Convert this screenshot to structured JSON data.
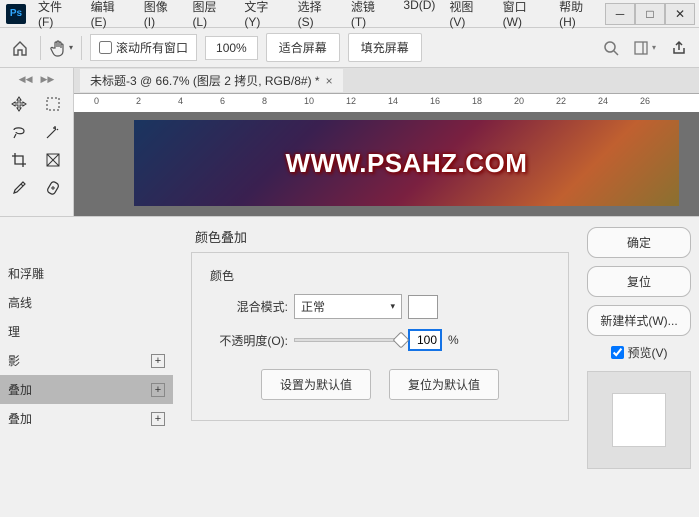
{
  "menu": {
    "file": "文件(F)",
    "edit": "编辑(E)",
    "image": "图像(I)",
    "layer": "图层(L)",
    "type": "文字(Y)",
    "select": "选择(S)",
    "filter": "滤镜(T)",
    "threeD": "3D(D)",
    "view": "视图(V)",
    "window": "窗口(W)",
    "help": "帮助(H)"
  },
  "toolbar": {
    "scroll_all": "滚动所有窗口",
    "zoom": "100%",
    "fit_screen": "适合屏幕",
    "fill_screen": "填充屏幕"
  },
  "doc": {
    "tab": "未标题-3 @ 66.7% (图层 2 拷贝, RGB/8#) *",
    "watermark": "WWW.PSAHZ.COM",
    "ruler": [
      "0",
      "2",
      "4",
      "6",
      "8",
      "10",
      "12",
      "14",
      "16",
      "18",
      "20",
      "22",
      "24",
      "26"
    ]
  },
  "dialog": {
    "styles": {
      "a": "",
      "b": "和浮雕",
      "c": "高线",
      "d": "理",
      "e": "影",
      "f": "叠加",
      "g": "叠加"
    },
    "title": "颜色叠加",
    "section": "颜色",
    "blend_label": "混合模式:",
    "blend_value": "正常",
    "opacity_label": "不透明度(O):",
    "opacity_value": "100",
    "pct": "%",
    "set_default": "设置为默认值",
    "reset_default": "复位为默认值",
    "ok": "确定",
    "cancel": "复位",
    "new_style": "新建样式(W)...",
    "preview": "预览(V)"
  }
}
